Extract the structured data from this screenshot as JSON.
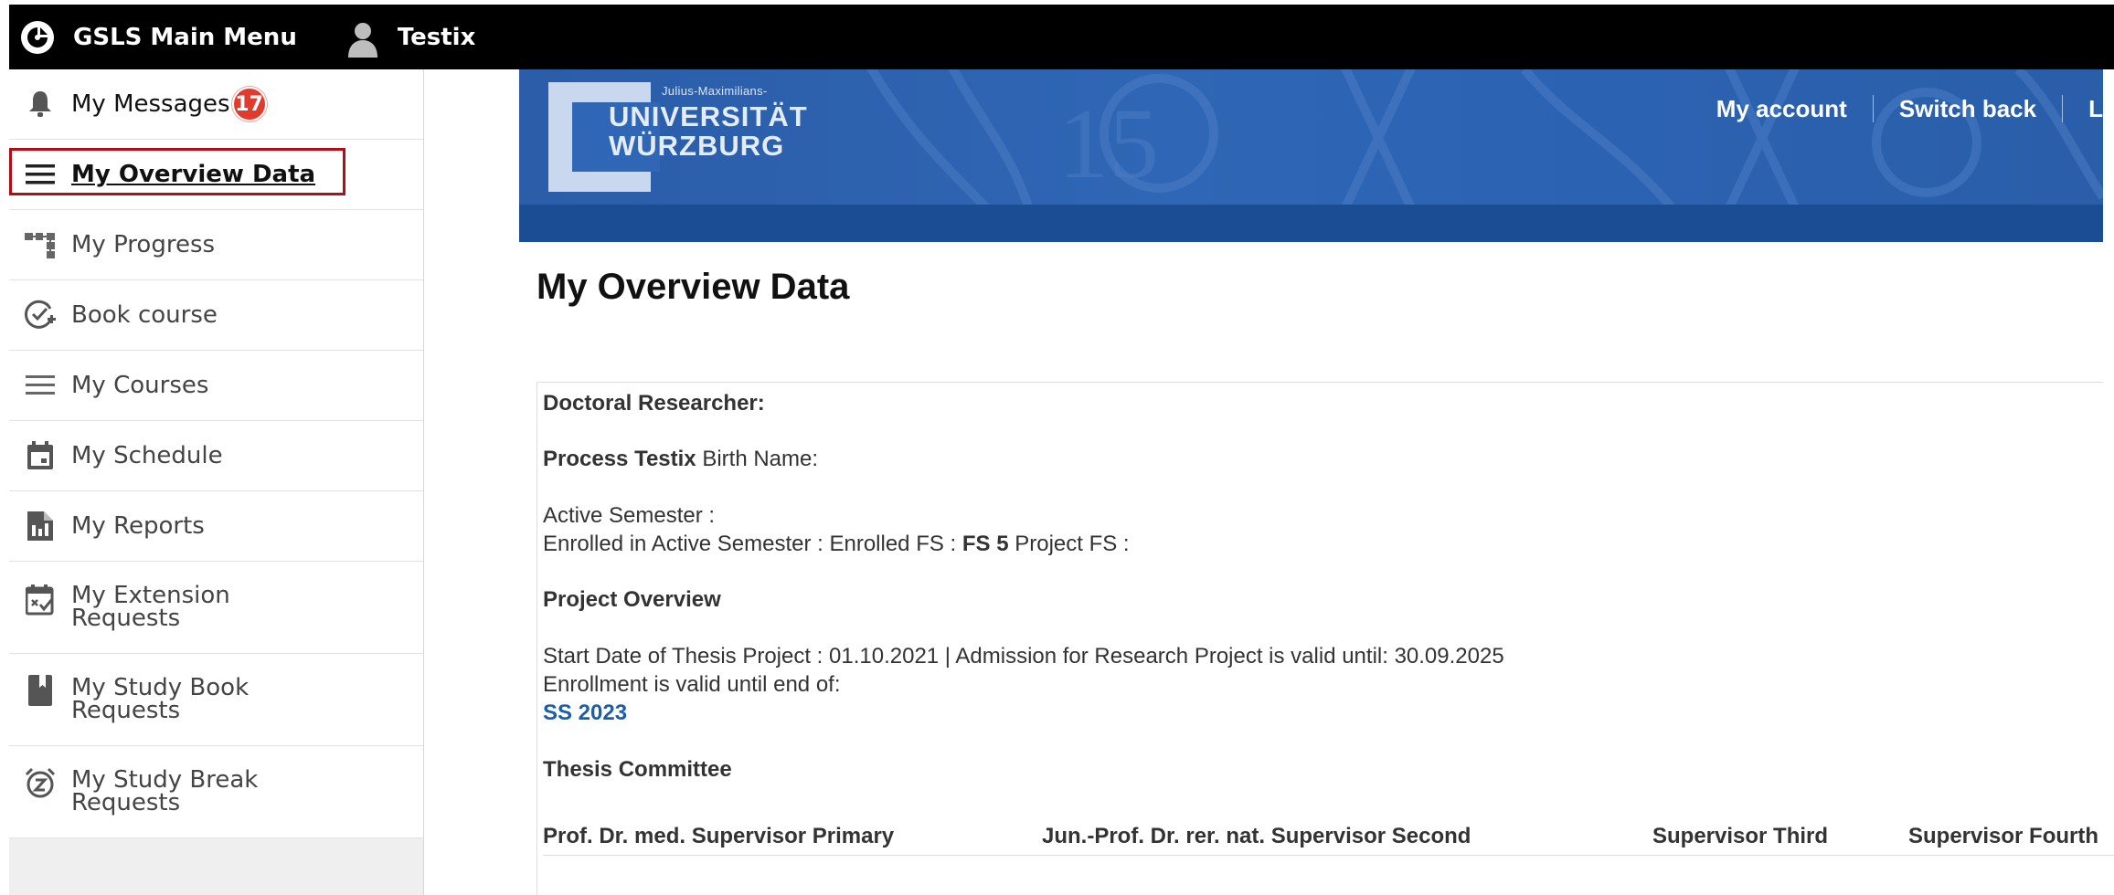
{
  "topbar": {
    "menu_label": "GSLS Main Menu",
    "user_label": "Testix",
    "icons": {
      "menu": "gsls-logo-icon",
      "user": "user-icon"
    }
  },
  "sidebar": {
    "items": [
      {
        "label": "My Messages",
        "icon": "bell-icon",
        "badge": "17"
      },
      {
        "label": "My Overview Data",
        "icon": "hamburger-icon",
        "active": true
      },
      {
        "label": "My Progress",
        "icon": "hierarchy-icon"
      },
      {
        "label": "Book course",
        "icon": "check-add-icon"
      },
      {
        "label": "My Courses",
        "icon": "list-icon"
      },
      {
        "label": "My Schedule",
        "icon": "calendar-icon"
      },
      {
        "label": "My Reports",
        "icon": "report-icon"
      },
      {
        "label": "My Extension Requests",
        "line1": "My Extension",
        "line2": "Requests",
        "icon": "calendar-check-icon"
      },
      {
        "label": "My Study Book Requests",
        "line1": "My Study Book",
        "line2": "Requests",
        "icon": "book-icon"
      },
      {
        "label": "My Study Break Requests",
        "line1": "My Study Break",
        "line2": "Requests",
        "icon": "snooze-alarm-icon"
      }
    ]
  },
  "banner": {
    "logo_small": "Julius-Maximilians-",
    "logo_line1": "UNIVERSITÄT",
    "logo_line2": "WÜRZBURG",
    "nav": [
      "My account",
      "Switch back",
      "L"
    ]
  },
  "main": {
    "title": "My Overview Data",
    "doctoral_researcher_label": "Doctoral Researcher:",
    "name": "Process Testix",
    "birth_name_label": "Birth Name:",
    "active_semester_label": "Active Semester :",
    "enrolled_label": "Enrolled in Active Semester : Enrolled FS :",
    "enrolled_fs": "FS 5",
    "project_fs_label": "Project FS :",
    "project_overview_label": "Project Overview",
    "start_date_text": "Start Date of Thesis Project : 01.10.2021 | Admission for Research Project is valid until: 30.09.2025",
    "enrollment_valid_label": "Enrollment is valid until end of:",
    "enrollment_semester": "SS 2023",
    "thesis_committee_label": "Thesis Committee",
    "committee": [
      "Prof. Dr. med. Supervisor Primary",
      "Jun.-Prof. Dr. rer. nat. Supervisor Second",
      "Supervisor Third",
      "Supervisor Fourth"
    ]
  },
  "colors": {
    "topbar": "#000000",
    "banner": "#2f66b5",
    "subbar": "#1a4d94",
    "badge": "#e23b2e",
    "highlight": "#b00d16",
    "link": "#1a5fa8"
  }
}
